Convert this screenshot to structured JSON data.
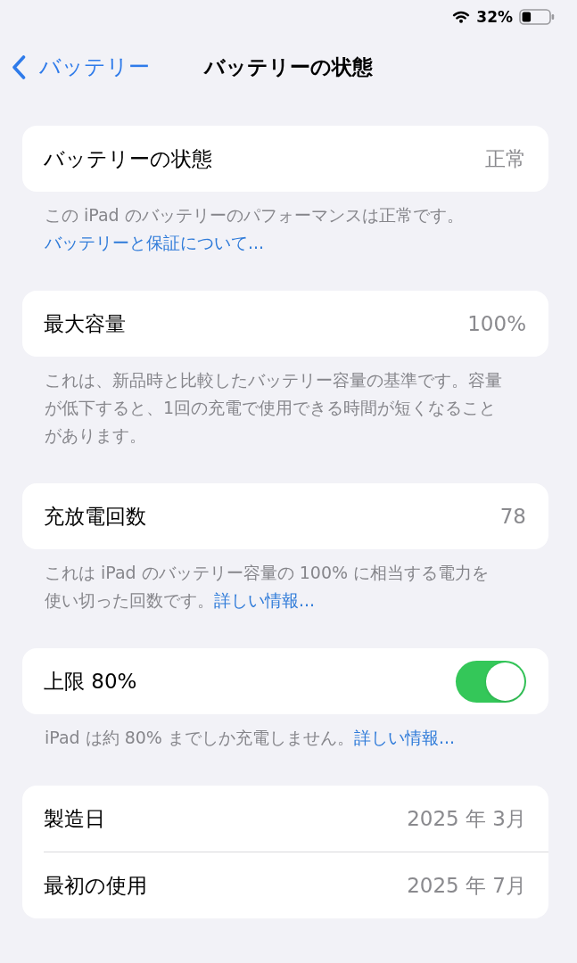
{
  "status_bar": {
    "battery_percent": "32%"
  },
  "nav": {
    "back": "バッテリー",
    "title": "バッテリーの状態"
  },
  "sections": [
    {
      "rows": [
        {
          "kind": "value",
          "label": "バッテリーの状態",
          "value": "正常"
        }
      ],
      "footer": {
        "text": "この iPad のバッテリーのパフォーマンスは正常です。",
        "link": "バッテリーと保証について..."
      }
    },
    {
      "rows": [
        {
          "kind": "value",
          "label": "最大容量",
          "value": "100%"
        }
      ],
      "footer": {
        "text": "これは、新品時と比較したバッテリー容量の基準です。容量が低下すると、1回の充電で使用できる時間が短くなることがあります。"
      }
    },
    {
      "rows": [
        {
          "kind": "value",
          "label": "充放電回数",
          "value": "78"
        }
      ],
      "footer": {
        "text": "これは iPad のバッテリー容量の 100% に相当する電力を使い切った回数です。",
        "link": "詳しい情報..."
      }
    },
    {
      "rows": [
        {
          "kind": "toggle",
          "label": "上限 80%",
          "on": true
        }
      ],
      "footer": {
        "text": "iPad は約 80% までしか充電しません。",
        "link": "詳しい情報..."
      }
    },
    {
      "rows": [
        {
          "kind": "value",
          "label": "製造日",
          "value": "2025 年 3月"
        },
        {
          "kind": "value",
          "label": "最初の使用",
          "value": "2025 年 7月"
        }
      ]
    }
  ]
}
